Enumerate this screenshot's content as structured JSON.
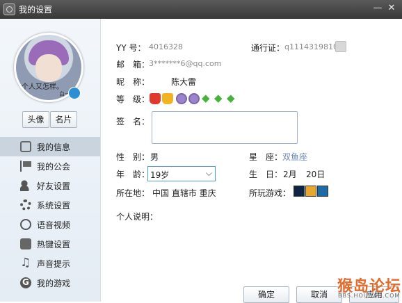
{
  "window": {
    "title": "我的设置",
    "minimize_glyph": "—",
    "close_glyph": "✕"
  },
  "sidebar": {
    "avatar_caption": "个人又怎样。",
    "avatar_caption2": "白一",
    "avatar_tab": "头像",
    "card_tab": "名片",
    "items": [
      {
        "label": "我的信息",
        "icon": "info-icon",
        "active": true
      },
      {
        "label": "我的公会",
        "icon": "flag-icon",
        "active": false
      },
      {
        "label": "好友设置",
        "icon": "friends-icon",
        "active": false
      },
      {
        "label": "系统设置",
        "icon": "gear-icon",
        "active": false
      },
      {
        "label": "语音视频",
        "icon": "voice-icon",
        "active": false
      },
      {
        "label": "热键设置",
        "icon": "hotkey-icon",
        "active": false
      },
      {
        "label": "声音提示",
        "icon": "music-note-icon",
        "active": false
      },
      {
        "label": "我的游戏",
        "icon": "game-icon",
        "active": false
      }
    ]
  },
  "profile": {
    "yy_label": "YY 号：",
    "yy_value": "4016328",
    "passport_label": "通行证：",
    "passport_value": "q1114319810",
    "email_label": "邮　箱：",
    "email_value": "3*******6@qq.com",
    "nickname_label": "昵　称：",
    "nickname_value": "陈大雷",
    "level_label": "等　级：",
    "signature_label": "签　名：",
    "gender_label": "性　别：",
    "gender_value": "男",
    "zodiac_label": "星　座：",
    "zodiac_value": "双鱼座",
    "age_label": "年　龄：",
    "age_value": "19岁",
    "birthday_label": "生　日：",
    "birthday_month": "2月",
    "birthday_day": "20日",
    "location_label": "所在地：",
    "location_value": "中国  直辖市  重庆",
    "games_label": "所玩游戏：",
    "description_label": "个人说明："
  },
  "buttons": {
    "ok": "确定",
    "cancel": "取消",
    "apply": "应用"
  },
  "watermark": {
    "text": "猴岛论坛",
    "sub": "BBS.HOUDAO.COM"
  },
  "colors": {
    "titlebar": "#4a4a4a",
    "sidebar_active": "#c9d4df",
    "input_focus": "#4e97d3"
  }
}
